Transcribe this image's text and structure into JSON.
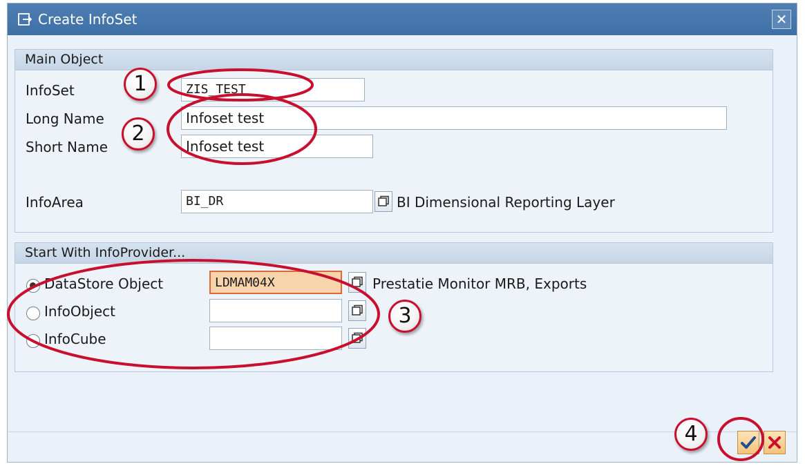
{
  "window": {
    "title": "Create InfoSet",
    "close_icon": "close-icon"
  },
  "main_object": {
    "group_title": "Main Object",
    "infoset": {
      "label": "InfoSet",
      "value": "ZIS_TEST"
    },
    "long_name": {
      "label": "Long Name",
      "value": "Infoset test"
    },
    "short_name": {
      "label": "Short Name",
      "value": "Infoset test"
    },
    "infoarea": {
      "label": "InfoArea",
      "value": "BI_DR",
      "description": "BI Dimensional Reporting Layer"
    }
  },
  "start_with": {
    "group_title": "Start With InfoProvider...",
    "options": [
      {
        "label": "DataStore Object",
        "value": "LDMAM04X",
        "description": "Prestatie Monitor MRB, Exports",
        "selected": true
      },
      {
        "label": "InfoObject",
        "value": "",
        "selected": false
      },
      {
        "label": "InfoCube",
        "value": "",
        "selected": false
      }
    ]
  },
  "footer": {
    "ok_icon": "checkmark-icon",
    "cancel_icon": "cancel-x-icon"
  },
  "annotations": {
    "step1": "1",
    "step2": "2",
    "step3": "3",
    "step4": "4",
    "color": "#c8102e"
  }
}
